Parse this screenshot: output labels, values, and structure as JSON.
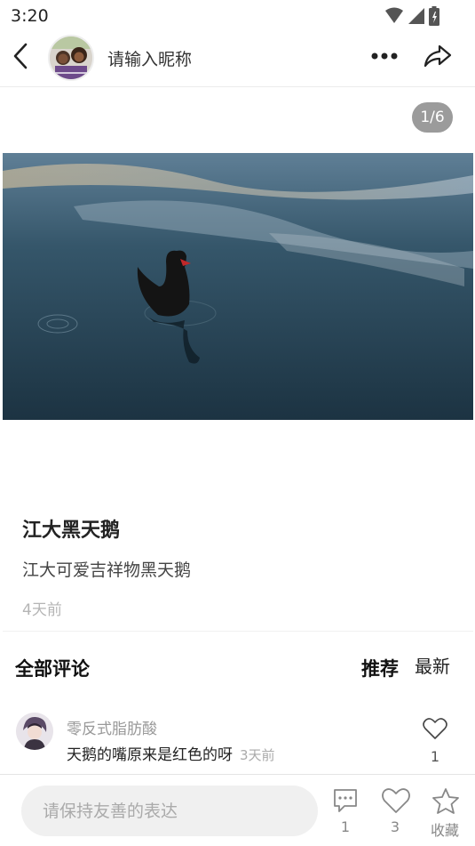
{
  "status_bar": {
    "time": "3:20"
  },
  "header": {
    "nickname": "请输入昵称"
  },
  "gallery": {
    "indicator": "1/6"
  },
  "post": {
    "title": "江大黑天鹅",
    "description": "江大可爱吉祥物黑天鹅",
    "time": "4天前"
  },
  "comments": {
    "title": "全部评论",
    "sort_recommended": "推荐",
    "sort_latest": "最新",
    "items": [
      {
        "user": "零反式脂肪酸",
        "text": "天鹅的嘴原来是红色的呀",
        "time": "3天前",
        "likes": "1"
      }
    ]
  },
  "bottom_bar": {
    "input_placeholder": "请保持友善的表达",
    "comment_count": "1",
    "like_count": "3",
    "favorite_label": "收藏"
  },
  "icons": {
    "back": "back-arrow-icon",
    "more": "more-dots-icon",
    "share": "share-icon",
    "wifi": "wifi-icon",
    "signal": "signal-icon",
    "battery": "battery-icon",
    "heart": "heart-icon",
    "comment": "comment-bubble-icon",
    "star": "star-icon"
  }
}
